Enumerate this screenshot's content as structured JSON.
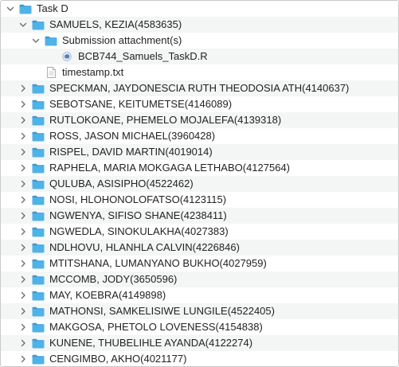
{
  "tree": [
    {
      "label": "Task D",
      "level": 0,
      "icon": "folder-icon",
      "expand": "expanded"
    },
    {
      "label": "SAMUELS, KEZIA(4583635)",
      "level": 1,
      "icon": "folder-icon",
      "expand": "expanded"
    },
    {
      "label": "Submission attachment(s)",
      "level": 2,
      "icon": "folder-icon",
      "expand": "expanded"
    },
    {
      "label": "BCB744_Samuels_TaskD.R",
      "level": 3,
      "icon": "r-file-icon",
      "expand": "none"
    },
    {
      "label": "timestamp.txt",
      "level": 2,
      "icon": "text-file-icon",
      "expand": "none"
    },
    {
      "label": "SPECKMAN, JAYDONESCIA RUTH THEODOSIA ATH(4140637)",
      "level": 1,
      "icon": "folder-icon",
      "expand": "collapsed"
    },
    {
      "label": "SEBOTSANE, KEITUMETSE(4146089)",
      "level": 1,
      "icon": "folder-icon",
      "expand": "collapsed"
    },
    {
      "label": "RUTLOKOANE, PHEMELO MOJALEFA(4139318)",
      "level": 1,
      "icon": "folder-icon",
      "expand": "collapsed"
    },
    {
      "label": "ROSS, JASON MICHAEL(3960428)",
      "level": 1,
      "icon": "folder-icon",
      "expand": "collapsed"
    },
    {
      "label": "RISPEL, DAVID MARTIN(4019014)",
      "level": 1,
      "icon": "folder-icon",
      "expand": "collapsed"
    },
    {
      "label": "RAPHELA, MARIA MOKGAGA LETHABO(4127564)",
      "level": 1,
      "icon": "folder-icon",
      "expand": "collapsed"
    },
    {
      "label": "QULUBA, ASISIPHO(4522462)",
      "level": 1,
      "icon": "folder-icon",
      "expand": "collapsed"
    },
    {
      "label": "NOSI, HLOHONOLOFATSO(4123115)",
      "level": 1,
      "icon": "folder-icon",
      "expand": "collapsed"
    },
    {
      "label": "NGWENYA, SIFISO SHANE(4238411)",
      "level": 1,
      "icon": "folder-icon",
      "expand": "collapsed"
    },
    {
      "label": "NGWEDLA, SINOKULAKHA(4027383)",
      "level": 1,
      "icon": "folder-icon",
      "expand": "collapsed"
    },
    {
      "label": "NDLHOVU, HLANHLA CALVIN(4226846)",
      "level": 1,
      "icon": "folder-icon",
      "expand": "collapsed"
    },
    {
      "label": "MTITSHANA, LUMANYANO BUKHO(4027959)",
      "level": 1,
      "icon": "folder-icon",
      "expand": "collapsed"
    },
    {
      "label": "MCCOMB, JODY(3650596)",
      "level": 1,
      "icon": "folder-icon",
      "expand": "collapsed"
    },
    {
      "label": "MAY, KOEBRA(4149898)",
      "level": 1,
      "icon": "folder-icon",
      "expand": "collapsed"
    },
    {
      "label": "MATHONSI, SAMKELISIWE LUNGILE(4522405)",
      "level": 1,
      "icon": "folder-icon",
      "expand": "collapsed"
    },
    {
      "label": "MAKGOSA, PHETOLO LOVENESS(4154838)",
      "level": 1,
      "icon": "folder-icon",
      "expand": "collapsed"
    },
    {
      "label": "KUNENE, THUBELIHLE AYANDA(4122274)",
      "level": 1,
      "icon": "folder-icon",
      "expand": "collapsed"
    },
    {
      "label": "CENGIMBO, AKHO(4021177)",
      "level": 1,
      "icon": "folder-icon",
      "expand": "collapsed"
    }
  ],
  "colors": {
    "folder_body": "#4fb3e8",
    "folder_tab": "#3a9ad6",
    "chevron": "#6d6d6d",
    "text": "#222222",
    "stripe": "#f4f5f5",
    "r_badge": "#2f6fb7"
  }
}
